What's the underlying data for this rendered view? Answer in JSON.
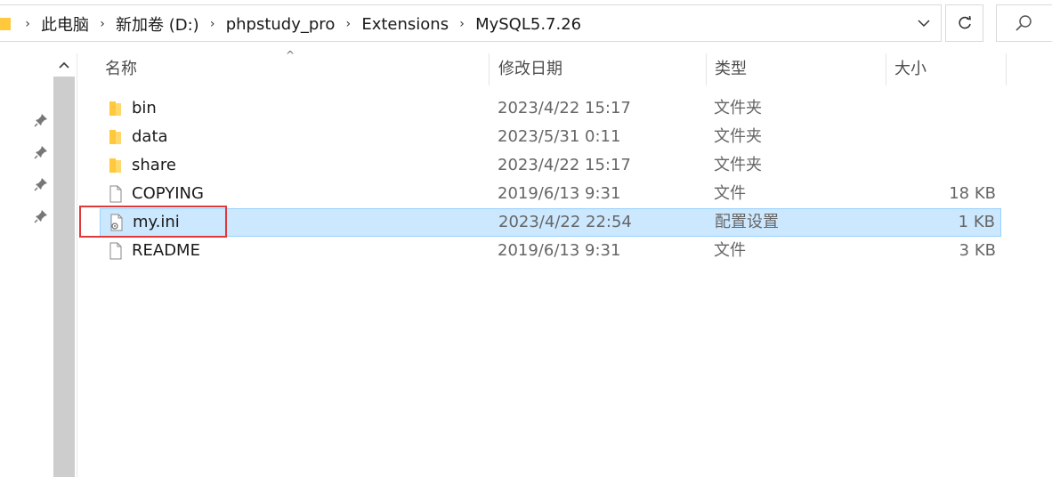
{
  "breadcrumb": {
    "items": [
      "此电脑",
      "新加卷 (D:)",
      "phpstudy_pro",
      "Extensions",
      "MySQL5.7.26"
    ]
  },
  "columns": {
    "name": "名称",
    "date": "修改日期",
    "type": "类型",
    "size": "大小"
  },
  "files": [
    {
      "name": "bin",
      "date": "2023/4/22 15:17",
      "type": "文件夹",
      "size": "",
      "kind": "folder",
      "selected": false
    },
    {
      "name": "data",
      "date": "2023/5/31 0:11",
      "type": "文件夹",
      "size": "",
      "kind": "folder",
      "selected": false
    },
    {
      "name": "share",
      "date": "2023/4/22 15:17",
      "type": "文件夹",
      "size": "",
      "kind": "folder",
      "selected": false
    },
    {
      "name": "COPYING",
      "date": "2019/6/13 9:31",
      "type": "文件",
      "size": "18 KB",
      "kind": "file",
      "selected": false
    },
    {
      "name": "my.ini",
      "date": "2023/4/22 22:54",
      "type": "配置设置",
      "size": "1 KB",
      "kind": "ini",
      "selected": true
    },
    {
      "name": "README",
      "date": "2019/6/13 9:31",
      "type": "文件",
      "size": "3 KB",
      "kind": "file",
      "selected": false
    }
  ],
  "colors": {
    "selection_bg": "#cce8ff",
    "selection_border": "#99d1ff",
    "highlight_box": "#e0383b",
    "folder": "#ffc83d"
  }
}
